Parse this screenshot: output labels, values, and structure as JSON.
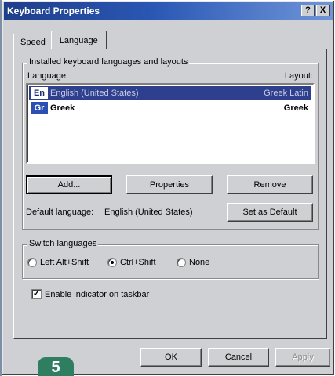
{
  "window": {
    "title": "Keyboard Properties",
    "help_btn": "?",
    "close_btn": "X"
  },
  "tabs": [
    {
      "label": "Speed",
      "active": false
    },
    {
      "label": "Language",
      "active": true
    }
  ],
  "installed": {
    "legend": "Installed keyboard languages and layouts",
    "col_language": "Language:",
    "col_layout": "Layout:",
    "rows": [
      {
        "abbr": "En",
        "language": "English (United States)",
        "layout": "Greek Latin",
        "selected": true
      },
      {
        "abbr": "Gr",
        "language": "Greek",
        "layout": "Greek",
        "selected": false
      }
    ],
    "buttons": {
      "add": "Add...",
      "properties": "Properties",
      "remove": "Remove"
    },
    "default_label": "Default language:",
    "default_value": "English (United States)",
    "set_default": "Set as Default"
  },
  "switch": {
    "legend": "Switch languages",
    "options": [
      {
        "label": "Left Alt+Shift",
        "checked": false
      },
      {
        "label": "Ctrl+Shift",
        "checked": true
      },
      {
        "label": "None",
        "checked": false
      }
    ]
  },
  "indicator": {
    "label": "Enable indicator on taskbar",
    "checked": true
  },
  "footer": {
    "ok": "OK",
    "cancel": "Cancel",
    "apply": "Apply"
  },
  "badge": "5",
  "colors": {
    "title_start": "#1f3e8a",
    "title_end": "#6f95d8",
    "selection": "#2e3f8e",
    "badge": "#2f7e62"
  }
}
